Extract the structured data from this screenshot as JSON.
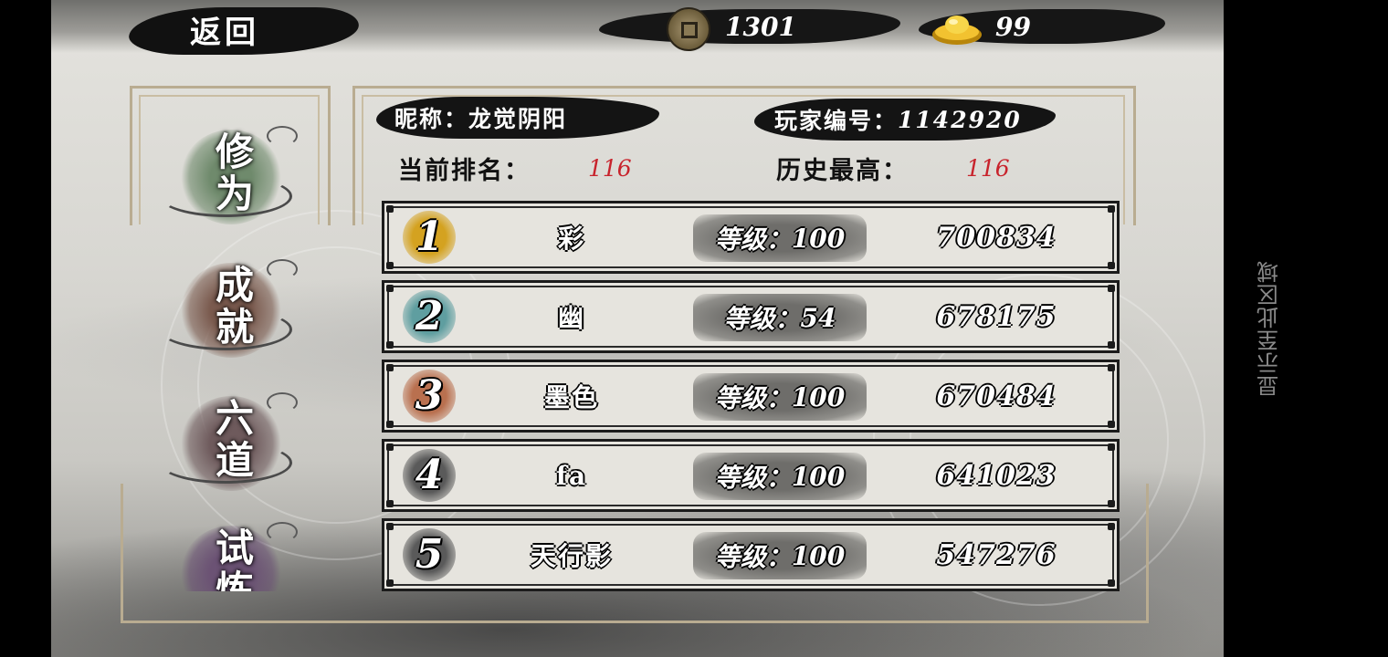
{
  "system": {
    "side_hint": "显示至此区域"
  },
  "topbar": {
    "back_label": "返回",
    "copper_coins": "1301",
    "gold_ingots": "99",
    "copper_icon": "copper-coin-icon",
    "gold_icon": "gold-ingot-icon"
  },
  "tabs": [
    {
      "top": "修",
      "bottom": "为",
      "color": "#6f8a6c",
      "active": true
    },
    {
      "top": "成",
      "bottom": "就",
      "color": "#7a5a4e",
      "active": false
    },
    {
      "top": "六",
      "bottom": "道",
      "color": "#6e5a5c",
      "active": false
    },
    {
      "top": "试",
      "bottom": "炼",
      "color": "#6b5274",
      "active": false
    }
  ],
  "profile": {
    "nickname_label": "昵称：",
    "nickname": "龙觉阴阳",
    "player_id_label": "玩家编号：",
    "player_id": "1142920",
    "current_rank_label": "当前排名：",
    "current_rank": "116",
    "best_rank_label": "历史最高：",
    "best_rank": "116"
  },
  "level_label": "等级：",
  "leaderboard": [
    {
      "rank": "1",
      "name": "彩",
      "level": "100",
      "score": "700834",
      "medal_color": "#d4a220"
    },
    {
      "rank": "2",
      "name": "幽",
      "level": "54",
      "score": "678175",
      "medal_color": "#5f9ea0"
    },
    {
      "rank": "3",
      "name": "墨色",
      "level": "100",
      "score": "670484",
      "medal_color": "#b9704f"
    },
    {
      "rank": "4",
      "name": "fa",
      "level": "100",
      "score": "641023",
      "medal_color": "#5a5a5a"
    },
    {
      "rank": "5",
      "name": "天行影",
      "level": "100",
      "score": "547276",
      "medal_color": "#5a5a5a"
    }
  ]
}
